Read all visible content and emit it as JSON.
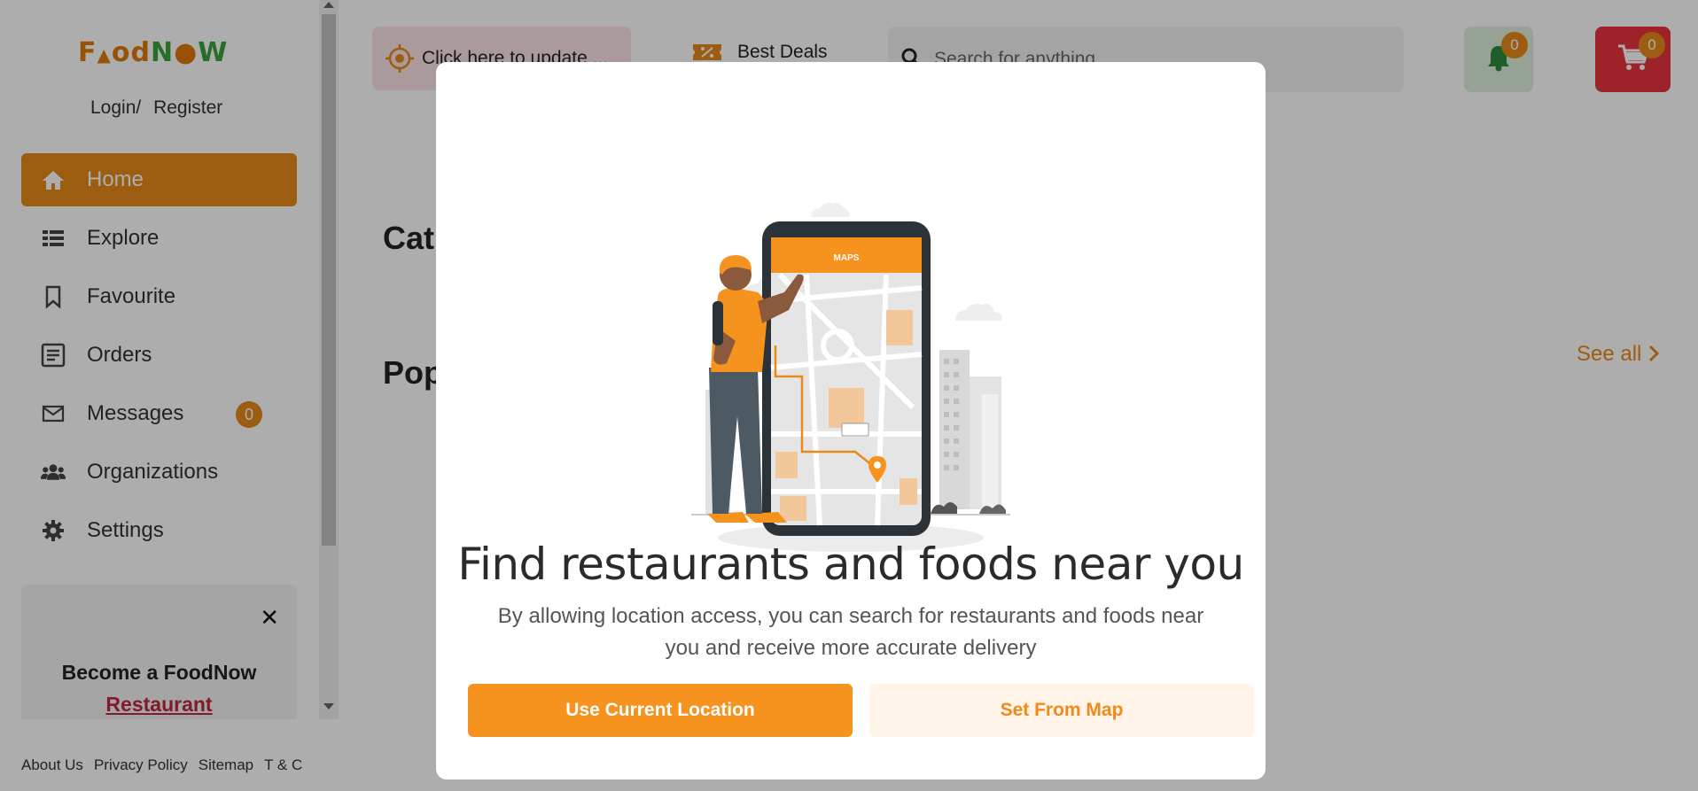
{
  "brand": {
    "logo_text": "FoodNOW"
  },
  "auth": {
    "login": "Login/",
    "register": "Register"
  },
  "sidebar": {
    "items": [
      {
        "label": "Home",
        "icon": "home-icon",
        "active": true
      },
      {
        "label": "Explore",
        "icon": "list-icon"
      },
      {
        "label": "Favourite",
        "icon": "bookmark-icon"
      },
      {
        "label": "Orders",
        "icon": "document-icon"
      },
      {
        "label": "Messages",
        "icon": "mail-icon",
        "badge": "0"
      },
      {
        "label": "Organizations",
        "icon": "users-icon"
      },
      {
        "label": "Settings",
        "icon": "gear-icon"
      }
    ],
    "promo": {
      "close": "✕",
      "line1": "Become a FoodNow",
      "line2": "Restaurant"
    }
  },
  "footer": {
    "links": [
      "About Us",
      "Privacy Policy",
      "Sitemap",
      "T & C"
    ]
  },
  "header": {
    "location_label": "Click here to update ...",
    "deals_label": "Best Deals",
    "search_placeholder": "Search for anything",
    "notifications_count": "0",
    "cart_count": "0"
  },
  "main": {
    "categories_title": "Cat",
    "popular_title": "Pop",
    "see_all": "See all"
  },
  "modal": {
    "title": "Find restaurants and foods near you",
    "description": "By allowing location access, you can search for restaurants and foods near you and receive more accurate delivery",
    "phone_header": "MAPS",
    "primary_button": "Use Current Location",
    "secondary_button": "Set From Map"
  },
  "colors": {
    "accent": "#e8891a",
    "primary_button": "#f5931e",
    "cart": "#e7333f",
    "promo_link": "#c0283b"
  }
}
